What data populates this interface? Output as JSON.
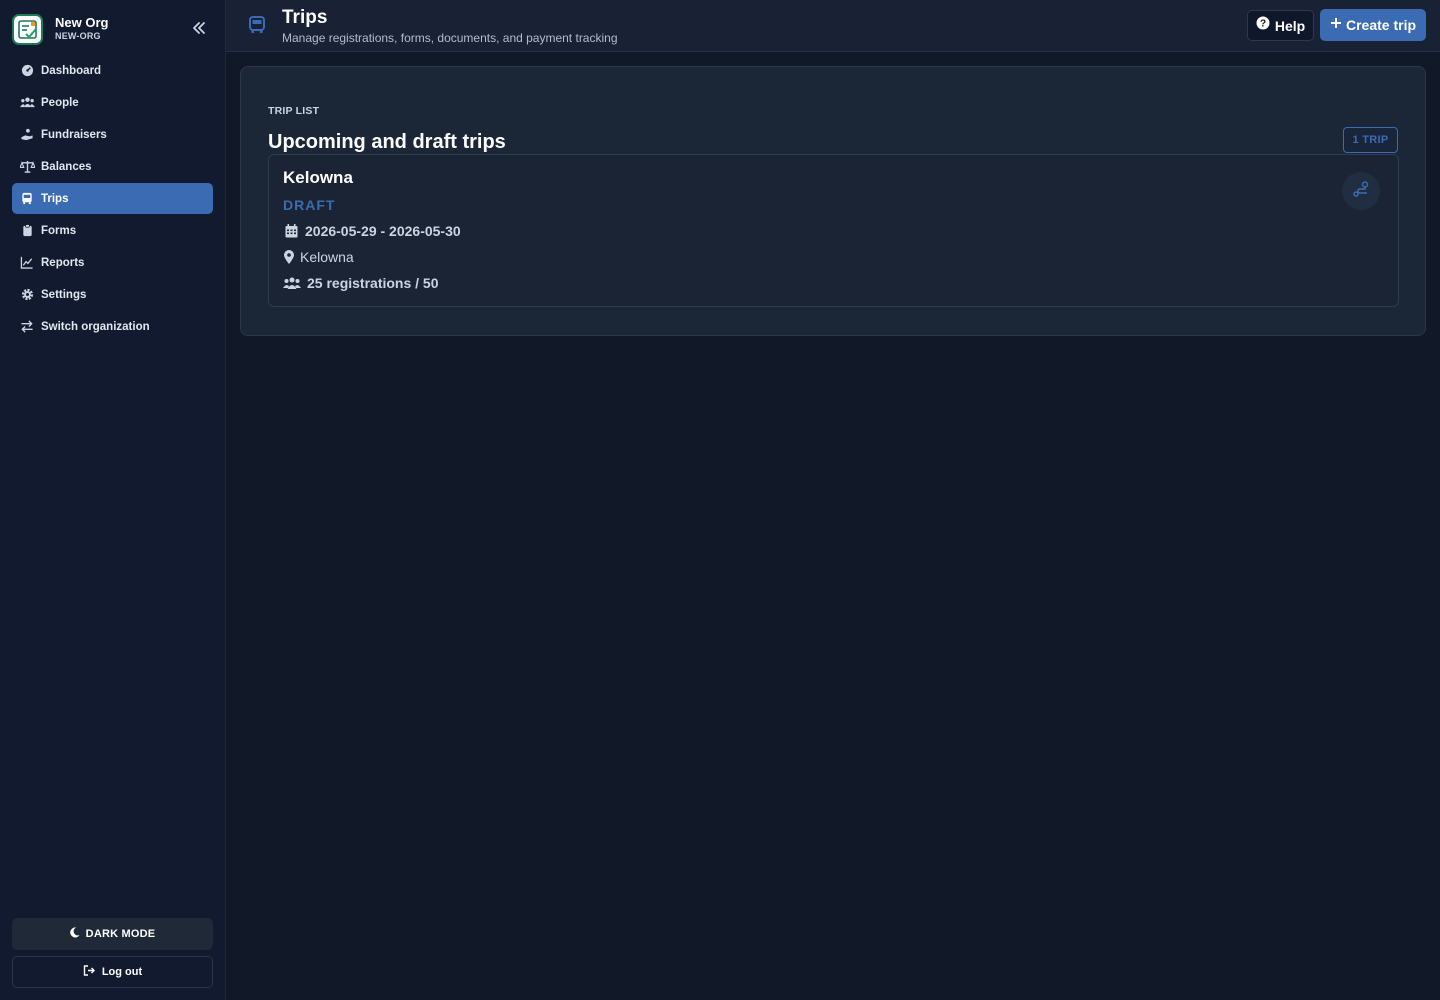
{
  "org": {
    "name": "New Org",
    "slug": "NEW-ORG"
  },
  "nav": {
    "items": [
      {
        "label": "Dashboard",
        "icon": "gauge-icon"
      },
      {
        "label": "People",
        "icon": "users-icon"
      },
      {
        "label": "Fundraisers",
        "icon": "hand-holding-icon"
      },
      {
        "label": "Balances",
        "icon": "scale-icon"
      },
      {
        "label": "Trips",
        "icon": "bus-icon",
        "active": true
      },
      {
        "label": "Forms",
        "icon": "clipboard-icon"
      },
      {
        "label": "Reports",
        "icon": "chart-line-icon"
      },
      {
        "label": "Settings",
        "icon": "gear-icon"
      },
      {
        "label": "Switch organization",
        "icon": "switch-arrows-icon"
      }
    ],
    "dark_mode_label": "DARK MODE",
    "logout_label": "Log out"
  },
  "header": {
    "title": "Trips",
    "subtitle": "Manage registrations, forms, documents, and payment tracking",
    "help_label": "Help",
    "create_label": "Create trip"
  },
  "trip_list": {
    "eyebrow": "TRIP LIST",
    "title": "Upcoming and draft trips",
    "count_badge": "1 TRIP",
    "trips": [
      {
        "name": "Kelowna",
        "status": "DRAFT",
        "dates": "2026-05-29 - 2026-05-30",
        "location": "Kelowna",
        "registrations": "25 registrations / 50"
      }
    ]
  },
  "colors": {
    "accent": "#3b6bb3",
    "background": "#111827",
    "sidebar": "#111a2e",
    "panel": "#1b2636"
  }
}
